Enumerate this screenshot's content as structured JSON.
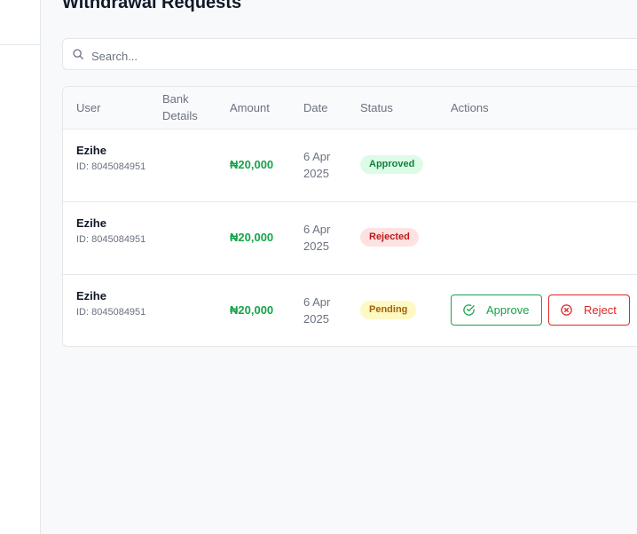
{
  "page": {
    "title": "Withdrawal Requests"
  },
  "search": {
    "placeholder": "Search...",
    "value": "",
    "icon": "search-icon"
  },
  "table": {
    "columns": [
      "User",
      "Bank Details",
      "Amount",
      "Date",
      "Status",
      "Actions"
    ],
    "rows": [
      {
        "user_name": "Ezihe",
        "user_id": "ID: 8045084951",
        "bank_details": "",
        "amount": "₦20,000",
        "date": "6 Apr 2025",
        "status": "Approved"
      },
      {
        "user_name": "Ezihe",
        "user_id": "ID: 8045084951",
        "bank_details": "",
        "amount": "₦20,000",
        "date": "6 Apr 2025",
        "status": "Rejected"
      },
      {
        "user_name": "Ezihe",
        "user_id": "ID: 8045084951",
        "bank_details": "",
        "amount": "₦20,000",
        "date": "6 Apr 2025",
        "status": "Pending",
        "actions": {
          "approve_label": "Approve",
          "reject_label": "Reject",
          "approve_icon": "check-circle-icon",
          "reject_icon": "x-circle-icon"
        }
      }
    ]
  },
  "colors": {
    "success": "#16a34a",
    "danger": "#dc2626",
    "warning": "#a16207"
  }
}
